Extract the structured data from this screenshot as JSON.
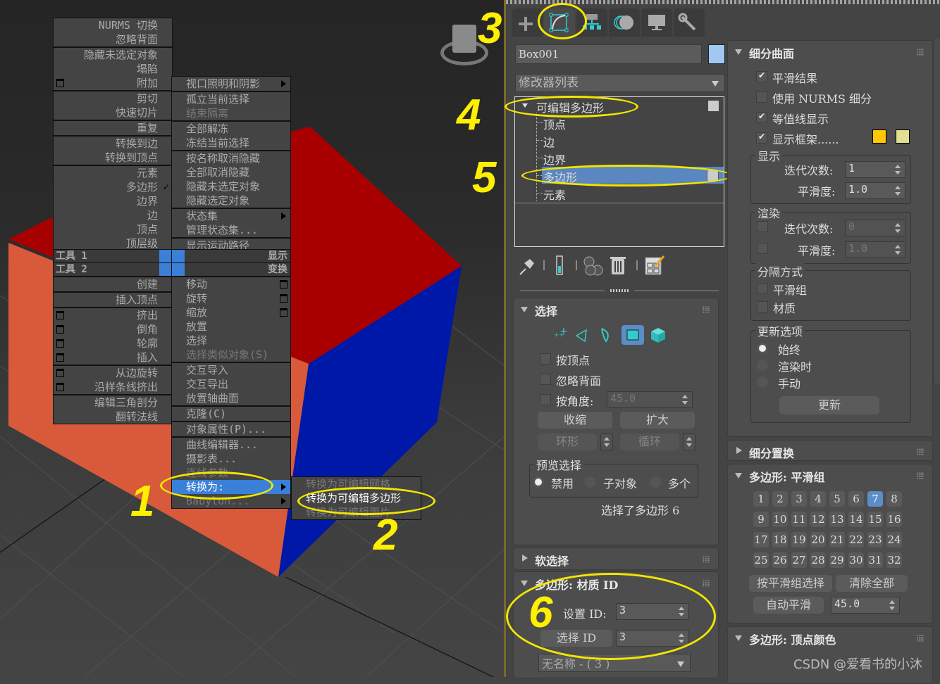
{
  "viewport": {
    "quad_left_top": [
      {
        "items": [
          {
            "label": "NURMS 切换"
          },
          {
            "label": "忽略背面"
          }
        ]
      },
      {
        "items": [
          {
            "label": "隐藏未选定对象"
          },
          {
            "label": "塌陷"
          },
          {
            "label": "附加",
            "settings": true
          }
        ]
      },
      {
        "items": [
          {
            "label": "剪切"
          },
          {
            "label": "快速切片"
          }
        ]
      },
      {
        "items": [
          {
            "label": "重复"
          }
        ]
      },
      {
        "items": [
          {
            "label": "转换到边"
          },
          {
            "label": "转换到顶点"
          }
        ]
      },
      {
        "items": [
          {
            "label": "元素"
          },
          {
            "label": "多边形",
            "checked": true
          },
          {
            "label": "边界"
          },
          {
            "label": "边"
          },
          {
            "label": "顶点"
          },
          {
            "label": "顶层级"
          }
        ]
      }
    ],
    "quad_right_top": [
      {
        "items": [
          {
            "label": "视口照明和阴影",
            "submenu": true
          }
        ]
      },
      {
        "items": [
          {
            "label": "孤立当前选择"
          },
          {
            "label": "结束隔离",
            "disabled": true
          }
        ]
      },
      {
        "items": [
          {
            "label": "全部解冻"
          },
          {
            "label": "冻结当前选择"
          }
        ]
      },
      {
        "items": [
          {
            "label": "按名称取消隐藏"
          },
          {
            "label": "全部取消隐藏"
          },
          {
            "label": "隐藏未选定对象"
          },
          {
            "label": "隐藏选定对象"
          }
        ]
      },
      {
        "items": [
          {
            "label": "状态集",
            "submenu": true
          },
          {
            "label": "管理状态集..."
          }
        ]
      },
      {
        "items": [
          {
            "label": "显示运动路径"
          }
        ]
      }
    ],
    "quad_titles": {
      "tools1": "工具 1",
      "tools2": "工具 2",
      "display": "显示",
      "transform": "变换"
    },
    "quad_left_bottom": [
      {
        "items": [
          {
            "label": "创建"
          }
        ]
      },
      {
        "items": [
          {
            "label": "插入顶点"
          }
        ]
      },
      {
        "items": [
          {
            "label": "挤出",
            "settings": true
          },
          {
            "label": "倒角",
            "settings": true
          },
          {
            "label": "轮廓",
            "settings": true
          },
          {
            "label": "插入",
            "settings": true
          }
        ]
      },
      {
        "items": [
          {
            "label": "从边旋转",
            "settings": true
          },
          {
            "label": "沿样条线挤出",
            "settings": true
          }
        ]
      },
      {
        "items": [
          {
            "label": "编辑三角剖分"
          },
          {
            "label": "翻转法线"
          }
        ]
      }
    ],
    "quad_right_bottom": [
      {
        "items": [
          {
            "label": "移动",
            "settings": true
          },
          {
            "label": "旋转",
            "settings": true
          },
          {
            "label": "缩放",
            "settings": true
          },
          {
            "label": "放置"
          },
          {
            "label": "选择"
          },
          {
            "label": "选择类似对象(S)",
            "disabled": true
          }
        ]
      },
      {
        "items": [
          {
            "label": "交互导入"
          },
          {
            "label": "交互导出"
          },
          {
            "label": "放置轴曲面"
          }
        ]
      },
      {
        "items": [
          {
            "label": "克隆(C)"
          }
        ]
      },
      {
        "items": [
          {
            "label": "对象属性(P)..."
          }
        ]
      },
      {
        "items": [
          {
            "label": "曲线编辑器..."
          },
          {
            "label": "摄影表..."
          },
          {
            "label": "连线参数",
            "disabled": true
          },
          {
            "label": "转换为:",
            "submenu": true,
            "highlighted": true
          },
          {
            "label": "Babylon...",
            "submenu": true,
            "disabled": true
          }
        ]
      }
    ],
    "convert_submenu": [
      {
        "label": "转换为可编辑网格",
        "disabled": true
      },
      {
        "label": "转换为可编辑多边形",
        "highlighted": true
      },
      {
        "label": "转换为可编辑面片",
        "disabled": true
      }
    ],
    "annotations": [
      "1",
      "2",
      "3",
      "4",
      "5",
      "6"
    ],
    "colors": {
      "top": "#a80000",
      "front": "#d85a3a",
      "side": "#0018a8",
      "annotation": "#ffef00"
    }
  },
  "panel": {
    "tabs": [
      {
        "name": "create",
        "icon": "plus-icon"
      },
      {
        "name": "modify",
        "icon": "modify-curve-icon",
        "active": true
      },
      {
        "name": "hierarchy",
        "icon": "hierarchy-icon"
      },
      {
        "name": "motion",
        "icon": "motion-icon"
      },
      {
        "name": "display",
        "icon": "monitor-icon"
      },
      {
        "name": "utilities",
        "icon": "wrench-icon"
      }
    ],
    "object_name": "Box001",
    "object_color": "#a0c8f0",
    "modifier_list": "修改器列表",
    "stack": {
      "root": "可编辑多边形",
      "children": [
        "顶点",
        "边",
        "边界",
        "多边形",
        "元素"
      ],
      "selected": "多边形"
    },
    "selection": {
      "title": "选择",
      "by_vertex": "按顶点",
      "ignore_backfacing": "忽略背面",
      "by_angle": "按角度:",
      "angle_value": "45.0",
      "shrink": "收缩",
      "grow": "扩大",
      "ring": "环形",
      "loop": "循环",
      "preview_group": "预览选择",
      "preview_options": [
        "禁用",
        "子对象",
        "多个"
      ],
      "preview_selected": "禁用",
      "status": "选择了多边形 6"
    },
    "soft_selection": {
      "title": "软选择"
    },
    "material_ids": {
      "title": "多边形: 材质 ID",
      "set_id_label": "设置 ID:",
      "set_id_value": "3",
      "select_id_button": "选择 ID",
      "select_id_value": "3",
      "name_dropdown": "无名称 - ( 3 )"
    },
    "subdivision": {
      "title": "细分曲面",
      "smooth_result": {
        "label": "平滑结果",
        "checked": true
      },
      "use_nurms": {
        "label": "使用 NURMS 细分",
        "checked": false
      },
      "isoline": {
        "label": "等值线显示",
        "checked": true
      },
      "show_cage": {
        "label": "显示框架......",
        "checked": true
      },
      "cage_colors": [
        "#ffc800",
        "#e0e090"
      ],
      "display_group": "显示",
      "iterations_label": "迭代次数:",
      "iterations_value": "1",
      "smoothness_label": "平滑度:",
      "smoothness_value": "1.0",
      "render_group": "渲染",
      "render_iterations_value": "0",
      "render_smoothness_value": "1.0",
      "separate_group": "分隔方式",
      "sep_smoothing": "平滑组",
      "sep_material": "材质",
      "update_group": "更新选项",
      "update_options": [
        "始终",
        "渲染时",
        "手动"
      ],
      "update_selected": "始终",
      "update_button": "更新"
    },
    "subdivision_displacement": {
      "title": "细分置换"
    },
    "smoothing_groups": {
      "title": "多边形: 平滑组",
      "groups": [
        "1",
        "2",
        "3",
        "4",
        "5",
        "6",
        "7",
        "8",
        "9",
        "10",
        "11",
        "12",
        "13",
        "14",
        "15",
        "16",
        "17",
        "18",
        "19",
        "20",
        "21",
        "22",
        "23",
        "24",
        "25",
        "26",
        "27",
        "28",
        "29",
        "30",
        "31",
        "32"
      ],
      "active": [
        "7"
      ],
      "select_by_sg": "按平滑组选择",
      "clear_all": "清除全部",
      "auto_smooth": "自动平滑",
      "auto_smooth_value": "45.0"
    },
    "vertex_colors": {
      "title": "多边形: 顶点颜色"
    },
    "watermark": "CSDN @爱看书的小沐"
  }
}
